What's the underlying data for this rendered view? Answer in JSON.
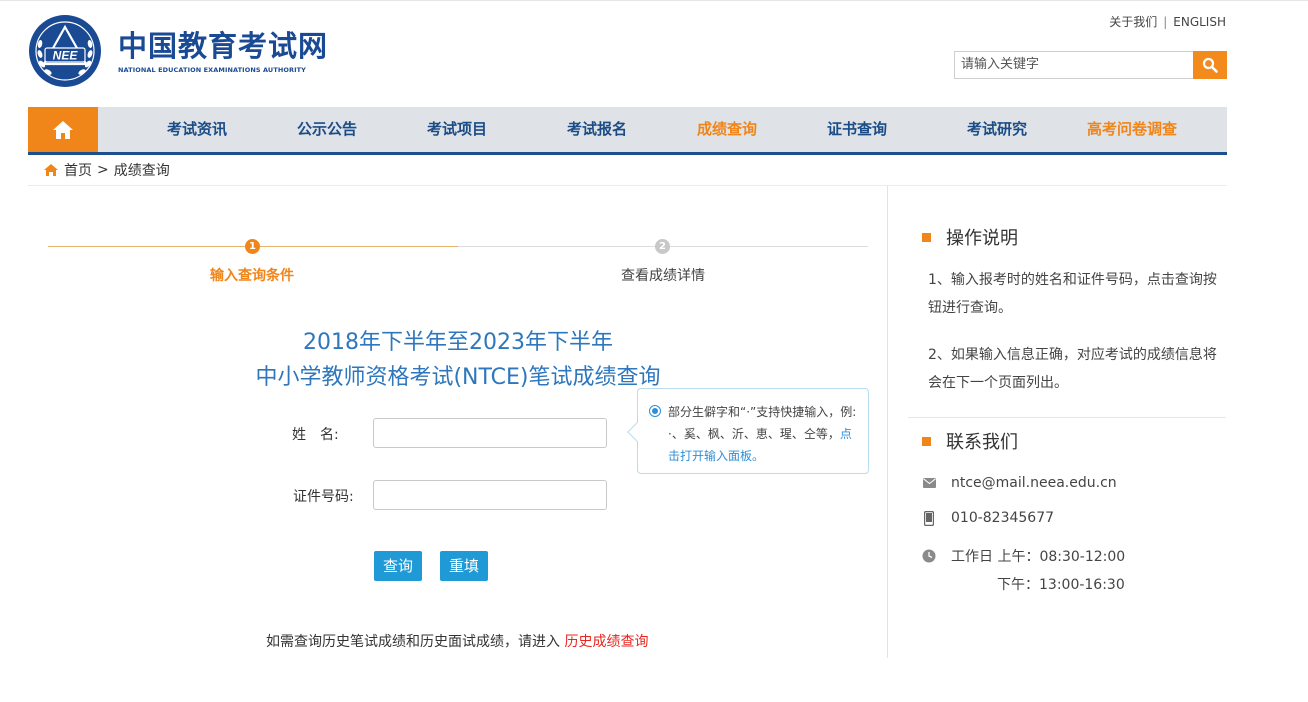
{
  "header": {
    "logo_cn": "中国教育考试网",
    "logo_en": "NATIONAL EDUCATION EXAMINATIONS AUTHORITY",
    "emblem_text": "NEE",
    "links": [
      "关于我们",
      "ENGLISH"
    ],
    "link_separator": "|",
    "search_placeholder": "请输入关键字"
  },
  "nav": {
    "home_icon": "home-icon",
    "items": [
      "考试资讯",
      "公示公告",
      "考试项目",
      "考试报名",
      "成绩查询",
      "证书查询",
      "考试研究",
      "高考问卷调查"
    ],
    "active": "成绩查询"
  },
  "breadcrumb": {
    "home": "首页",
    "separator": ">",
    "current": "成绩查询"
  },
  "steps": [
    {
      "num": "1",
      "label": "输入查询条件",
      "state": "current"
    },
    {
      "num": "2",
      "label": "查看成绩详情",
      "state": "pending"
    }
  ],
  "title": {
    "line1": "2018年下半年至2023年下半年",
    "line2": "中小学教师资格考试(NTCE)笔试成绩查询"
  },
  "form": {
    "name_label": "姓　名:",
    "id_label": "证件号码:",
    "name_value": "",
    "id_value": "",
    "query_button": "查询",
    "reset_button": "重填"
  },
  "tip": {
    "text": "部分生僻字和“·”支持快捷输入，例: ·、奚、枫、沂、恵、瑆、仝等，",
    "link": "点击打开输入面板。"
  },
  "history": {
    "text": "如需查询历史笔试成绩和历史面试成绩，请进入 ",
    "link": "历史成绩查询"
  },
  "sidebar": {
    "instructions_title": "操作说明",
    "instructions": [
      "1、输入报考时的姓名和证件号码，点击查询按钮进行查询。",
      "2、如果输入信息正确，对应考试的成绩信息将会在下一个页面列出。"
    ],
    "contact_title": "联系我们",
    "email": "ntce@mail.neea.edu.cn",
    "phone": "010-82345677",
    "hours_am": "工作日 上午：08:30-12:00",
    "hours_pm": "下午：13:00-16:30"
  },
  "colors": {
    "accent": "#f08519",
    "brand_blue": "#1b4c86",
    "title_blue": "#2e77bd",
    "button_blue": "#1f9ad6",
    "link_red": "#e8261f"
  }
}
